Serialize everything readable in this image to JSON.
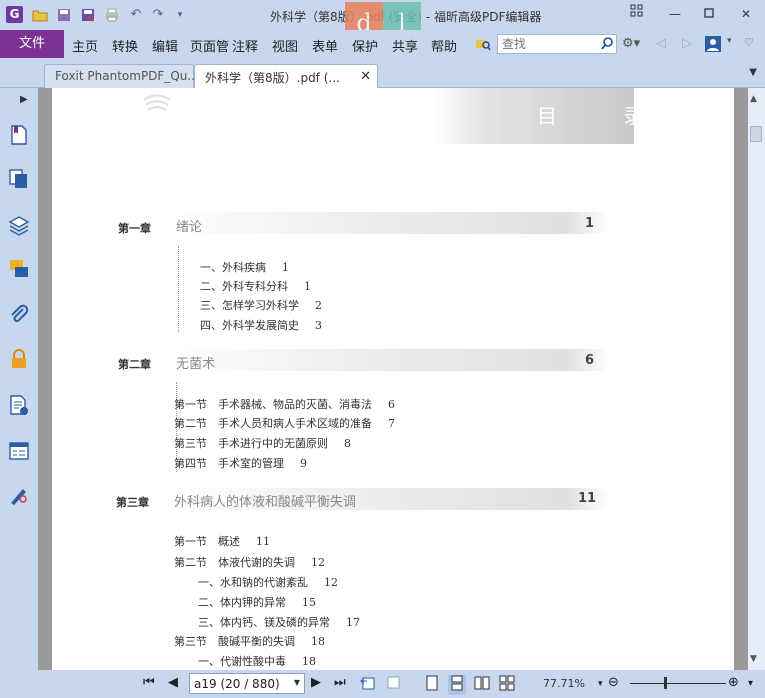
{
  "window": {
    "title": "外科学（第8版）.pdf (安全) - 福昕高级PDF编辑器"
  },
  "quick_access": {
    "icons": [
      "open-icon",
      "save-icon",
      "save-as-icon",
      "print-icon",
      "undo-icon",
      "redo-icon",
      "customize-icon"
    ]
  },
  "menu": {
    "file": "文件",
    "items": [
      "主页",
      "转换",
      "编辑",
      "页面管",
      "注释",
      "视图",
      "表单",
      "保护",
      "共享",
      "帮助"
    ]
  },
  "search": {
    "placeholder": "查找"
  },
  "tabs": [
    {
      "label": "Foxit PhantomPDF_Qu..."
    },
    {
      "label": "外科学（第8版）.pdf (..."
    }
  ],
  "document": {
    "header": "目 录",
    "chapters": [
      {
        "label": "第一章",
        "title": "绪论",
        "page": "1",
        "entries": [
          {
            "text": "一、外科疾病",
            "page": "1"
          },
          {
            "text": "二、外科专科分科",
            "page": "1"
          },
          {
            "text": "三、怎样学习外科学",
            "page": "2"
          },
          {
            "text": "四、外科学发展简史",
            "page": "3"
          }
        ]
      },
      {
        "label": "第二章",
        "title": "无菌术",
        "page": "6",
        "entries": [
          {
            "text": "第一节　手术器械、物品的灭菌、消毒法",
            "page": "6"
          },
          {
            "text": "第二节　手术人员和病人手术区域的准备",
            "page": "7"
          },
          {
            "text": "第三节　手术进行中的无菌原则",
            "page": "8"
          },
          {
            "text": "第四节　手术室的管理",
            "page": "9"
          }
        ]
      },
      {
        "label": "第三章",
        "title": "外科病人的体液和酸碱平衡失调",
        "page": "11",
        "entries": [
          {
            "text": "第一节　概述",
            "page": "11"
          },
          {
            "text": "第二节　体液代谢的失调",
            "page": "12"
          },
          {
            "text": "一、水和钠的代谢紊乱",
            "page": "12"
          },
          {
            "text": "二、体内钾的异常",
            "page": "15"
          },
          {
            "text": "三、体内钙、镁及磷的异常",
            "page": "17"
          },
          {
            "text": "第三节　酸碱平衡的失调",
            "page": "18"
          },
          {
            "text": "一、代谢性酸中毒",
            "page": "18"
          }
        ]
      }
    ]
  },
  "status": {
    "page_field": "a19 (20 / 880)",
    "zoom": "77.71%"
  },
  "colors": {
    "chrome": "#c7d7ee",
    "file_tab": "#7b3293",
    "page_bg": "#9a9a9a"
  }
}
